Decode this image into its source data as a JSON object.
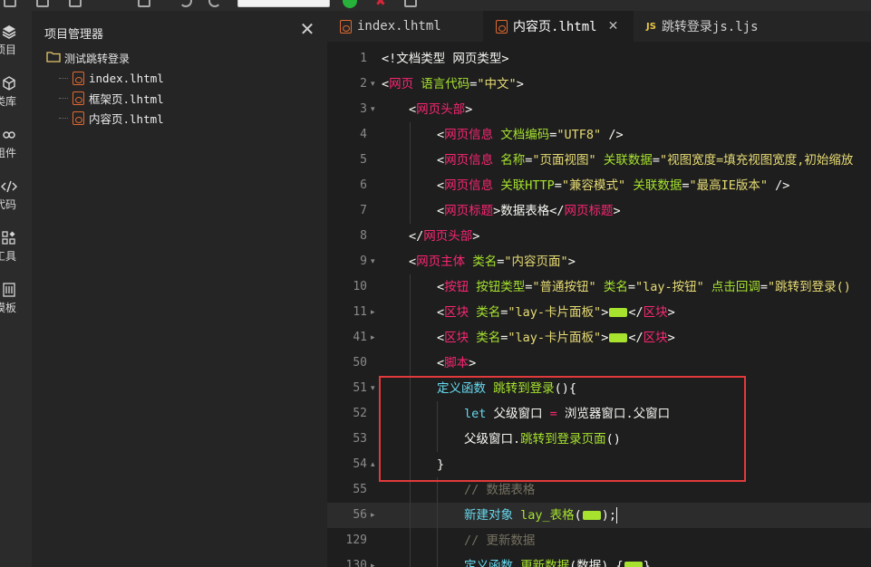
{
  "toolbar": {
    "input_value": "",
    "icons": [
      "save-icon",
      "new-file-icon",
      "print-icon",
      "undo-icon",
      "redo-icon",
      "run-icon",
      "stop-icon",
      "debug-icon"
    ]
  },
  "activity_bar": [
    {
      "label": "项目",
      "icon": "layers-icon"
    },
    {
      "label": "类库",
      "icon": "cube-icon"
    },
    {
      "label": "组件",
      "icon": "link-icon"
    },
    {
      "label": "代码",
      "icon": "code-icon"
    },
    {
      "label": "工具",
      "icon": "tools-icon"
    },
    {
      "label": "模板",
      "icon": "template-icon"
    }
  ],
  "explorer": {
    "title": "项目管理器",
    "close_glyph": "✕",
    "folder": "测试跳转登录",
    "files": [
      "index.lhtml",
      "框架页.lhtml",
      "内容页.lhtml"
    ]
  },
  "tabs": [
    {
      "label": "index.lhtml",
      "active": false
    },
    {
      "label": "内容页.lhtml",
      "active": true,
      "close": "✕"
    },
    {
      "label": "跳转登录js.ljs",
      "active": false,
      "badge": "JS"
    }
  ],
  "code": {
    "line_numbers": [
      "1",
      "2",
      "3",
      "4",
      "5",
      "6",
      "7",
      "8",
      "9",
      "10",
      "11",
      "41",
      "50",
      "51",
      "52",
      "53",
      "54",
      "55",
      "56",
      "129",
      "130"
    ],
    "l1": {
      "a": "<!文档类型 网页类型>"
    },
    "l2": {
      "p1": "<",
      "tag": "网页",
      "attr": " 语言代码",
      "eq": "=",
      "str": "\"中文\"",
      "p2": ">"
    },
    "l3": {
      "p1": "<",
      "tag": "网页头部",
      "p2": ">"
    },
    "l4": {
      "p1": "<",
      "tag": "网页信息",
      "attr": " 文档编码",
      "eq": "=",
      "str": "\"UTF8\"",
      "p2": " />"
    },
    "l5": {
      "p1": "<",
      "tag": "网页信息",
      "attr": " 名称",
      "eq": "=",
      "str": "\"页面视图\"",
      "attr2": " 关联数据",
      "eq2": "=",
      "str2": "\"视图宽度=填充视图宽度,初始缩放"
    },
    "l6": {
      "p1": "<",
      "tag": "网页信息",
      "attr": " 关联HTTP",
      "eq": "=",
      "str": "\"兼容模式\"",
      "attr2": " 关联数据",
      "eq2": "=",
      "str2": "\"最高IE版本\"",
      "p2": " />"
    },
    "l7": {
      "p1": "<",
      "tag": "网页标题",
      "p2": ">",
      "text": "数据表格",
      "p3": "</",
      "tag2": "网页标题",
      "p4": ">"
    },
    "l8": {
      "p1": "</",
      "tag": "网页头部",
      "p2": ">"
    },
    "l9": {
      "p1": "<",
      "tag": "网页主体",
      "attr": " 类名",
      "eq": "=",
      "str": "\"内容页面\"",
      "p2": ">"
    },
    "l10": {
      "p1": "<",
      "tag": "按钮",
      "attr": " 按钮类型",
      "eq": "=",
      "str": "\"普通按钮\"",
      "attr2": " 类名",
      "eq2": "=",
      "str2": "\"lay-按钮\"",
      "attr3": " 点击回调",
      "eq3": "=",
      "str3": "\"跳转到登录()"
    },
    "l11": {
      "p1": "<",
      "tag": "区块",
      "attr": " 类名",
      "eq": "=",
      "str": "\"lay-卡片面板\"",
      "p2": ">",
      "p3": "</",
      "tag2": "区块",
      "p4": ">"
    },
    "l41": {
      "p1": "<",
      "tag": "区块",
      "attr": " 类名",
      "eq": "=",
      "str": "\"lay-卡片面板\"",
      "p2": ">",
      "p3": "</",
      "tag2": "区块",
      "p4": ">"
    },
    "l50": {
      "p1": "<",
      "tag": "脚本",
      "p2": ">"
    },
    "l51": {
      "kw": "定义函数",
      "fn": " 跳转到登录",
      "p": "(){"
    },
    "l52": {
      "kw": "let",
      "v": " 父级窗口 ",
      "op": "=",
      "r": " 浏览器窗口",
      "dot": ".",
      "r2": "父窗口"
    },
    "l53": {
      "v": "父级窗口",
      "dot": ".",
      "fn": "跳转到登录页面",
      "p": "()"
    },
    "l54": {
      "p": "}"
    },
    "l55": {
      "c": "// 数据表格"
    },
    "l56": {
      "kw": "新建对象",
      "fn": " lay_表格",
      "p": "(",
      "p2": ");"
    },
    "l129": {
      "c": "// 更新数据"
    },
    "l130": {
      "kw": "定义函数",
      "fn": " 更新数据",
      "p": "(",
      "arg": "数据",
      "p2": ") {",
      "p3": "}"
    }
  },
  "colors": {
    "tag": "#f92672",
    "attr": "#a6e22e",
    "string": "#e6db74",
    "keyword": "#66d9ef",
    "highlight_box": "#e23a3a"
  }
}
